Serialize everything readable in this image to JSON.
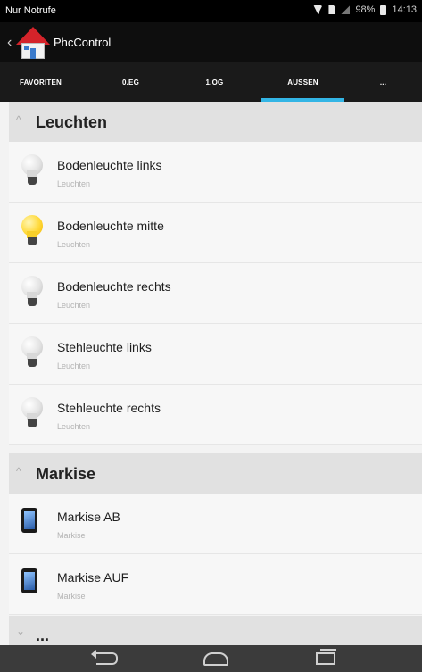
{
  "status_bar": {
    "carrier": "Nur Notrufe",
    "battery": "98%",
    "time": "14:13"
  },
  "action_bar": {
    "title": "PhcControl"
  },
  "tabs": [
    {
      "label": "FAVORITEN"
    },
    {
      "label": "0.EG"
    },
    {
      "label": "1.OG"
    },
    {
      "label": "AUSSEN",
      "active": true
    },
    {
      "label": "..."
    }
  ],
  "sections": [
    {
      "title": "Leuchten",
      "items": [
        {
          "name": "Bodenleuchte links",
          "category": "Leuchten",
          "icon": "bulb-off-icon"
        },
        {
          "name": "Bodenleuchte mitte",
          "category": "Leuchten",
          "icon": "bulb-on-icon"
        },
        {
          "name": "Bodenleuchte rechts",
          "category": "Leuchten",
          "icon": "bulb-off-icon"
        },
        {
          "name": "Stehleuchte links",
          "category": "Leuchten",
          "icon": "bulb-off-icon"
        },
        {
          "name": "Stehleuchte rechts",
          "category": "Leuchten",
          "icon": "bulb-off-icon"
        }
      ]
    },
    {
      "title": "Markise",
      "items": [
        {
          "name": "Markise AB",
          "category": "Markise",
          "icon": "tablet-icon"
        },
        {
          "name": "Markise AUF",
          "category": "Markise",
          "icon": "tablet-icon"
        }
      ]
    },
    {
      "title": "..."
    }
  ],
  "colors": {
    "tab_indicator": "#33b5e5",
    "bulb_on": "#ffd93a"
  }
}
